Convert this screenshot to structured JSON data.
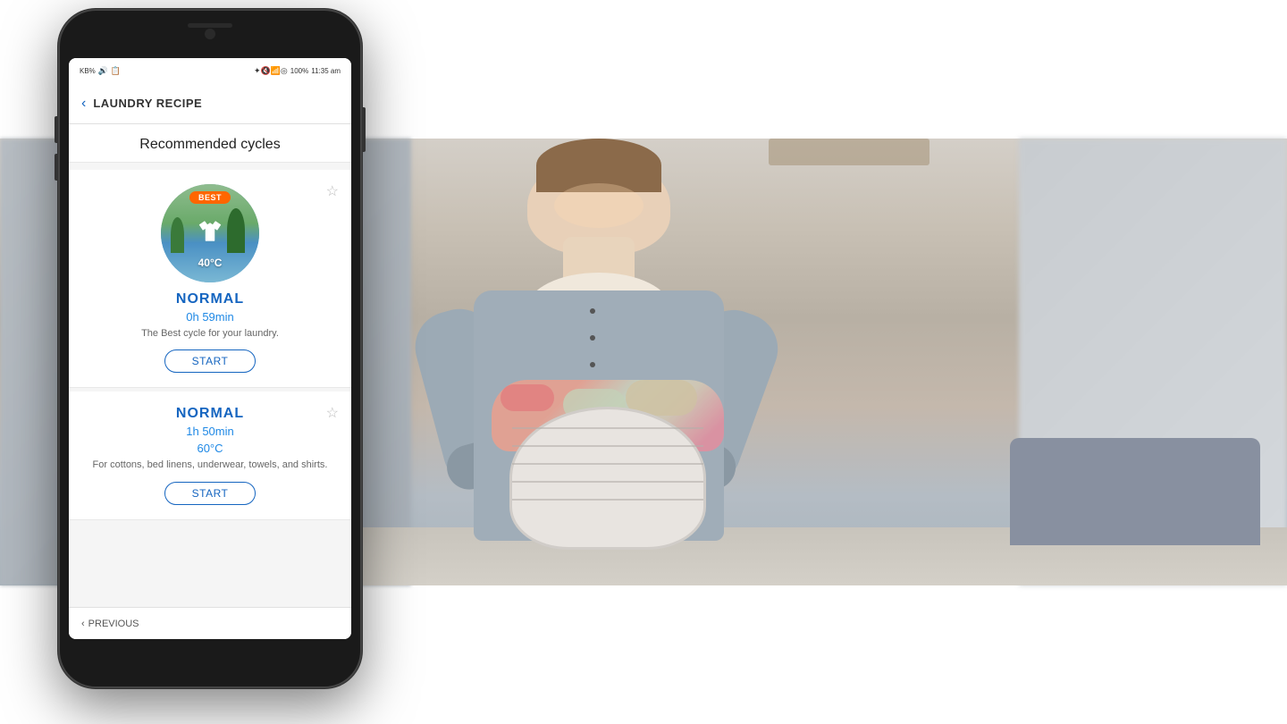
{
  "page": {
    "background": {
      "top_white_height": 155,
      "bottom_white_height": 155
    }
  },
  "phone": {
    "status_bar": {
      "left_text": "KB% 🔊 📋 ☁",
      "time": "11:35 am",
      "battery": "100%",
      "signal_icons": "✦ 🔇 📶 ◎"
    },
    "app_bar": {
      "back_icon": "‹",
      "title": "LAUNDRY RECIPE"
    },
    "screen": {
      "recommended_cycles_header": "Recommended cycles",
      "card1": {
        "best_badge": "BEST",
        "temperature": "40°C",
        "name": "NORMAL",
        "duration": "0h 59min",
        "description": "The Best cycle for your laundry.",
        "start_label": "START"
      },
      "card2": {
        "name": "NORMAL",
        "duration": "1h 50min",
        "temperature": "60°C",
        "description": "For cottons, bed linens, underwear, towels, and shirts.",
        "start_label": "START"
      },
      "bottom_nav": {
        "back_icon": "‹",
        "previous_label": "PREVIOUS"
      }
    }
  }
}
